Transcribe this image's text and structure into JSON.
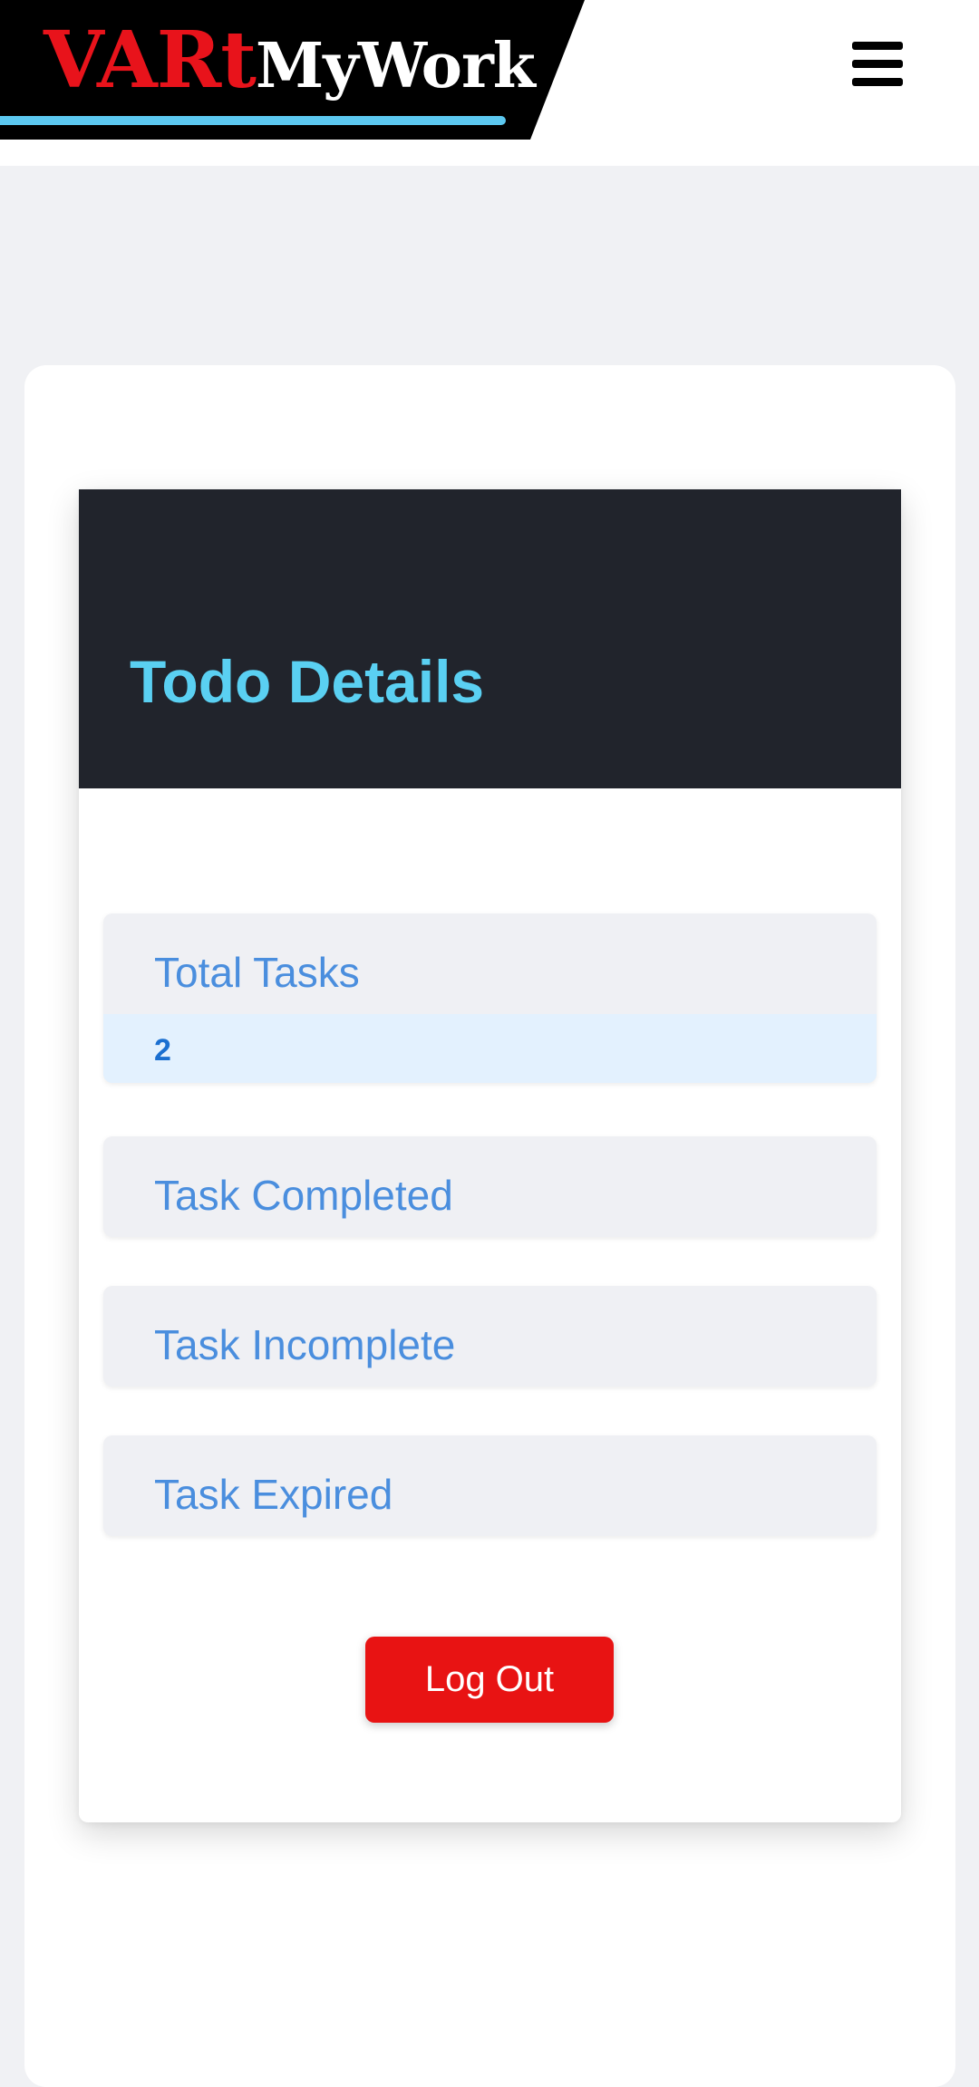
{
  "header": {
    "logo_part1": "VARt",
    "logo_part2": "MyWork",
    "menu_icon": "hamburger-menu-icon"
  },
  "card": {
    "title": "Todo Details"
  },
  "stats": [
    {
      "label": "Total Tasks",
      "value": "2"
    },
    {
      "label": "Task Completed"
    },
    {
      "label": "Task Incomplete"
    },
    {
      "label": "Task Expired"
    }
  ],
  "actions": {
    "logout_label": "Log Out"
  },
  "colors": {
    "logo_red": "#e8131b",
    "logo_accent": "#5cc8f0",
    "header_dark": "#21242c",
    "title_cyan": "#5ad0f2",
    "stat_label_blue": "#4a8ede",
    "logout_red": "#e81313"
  }
}
